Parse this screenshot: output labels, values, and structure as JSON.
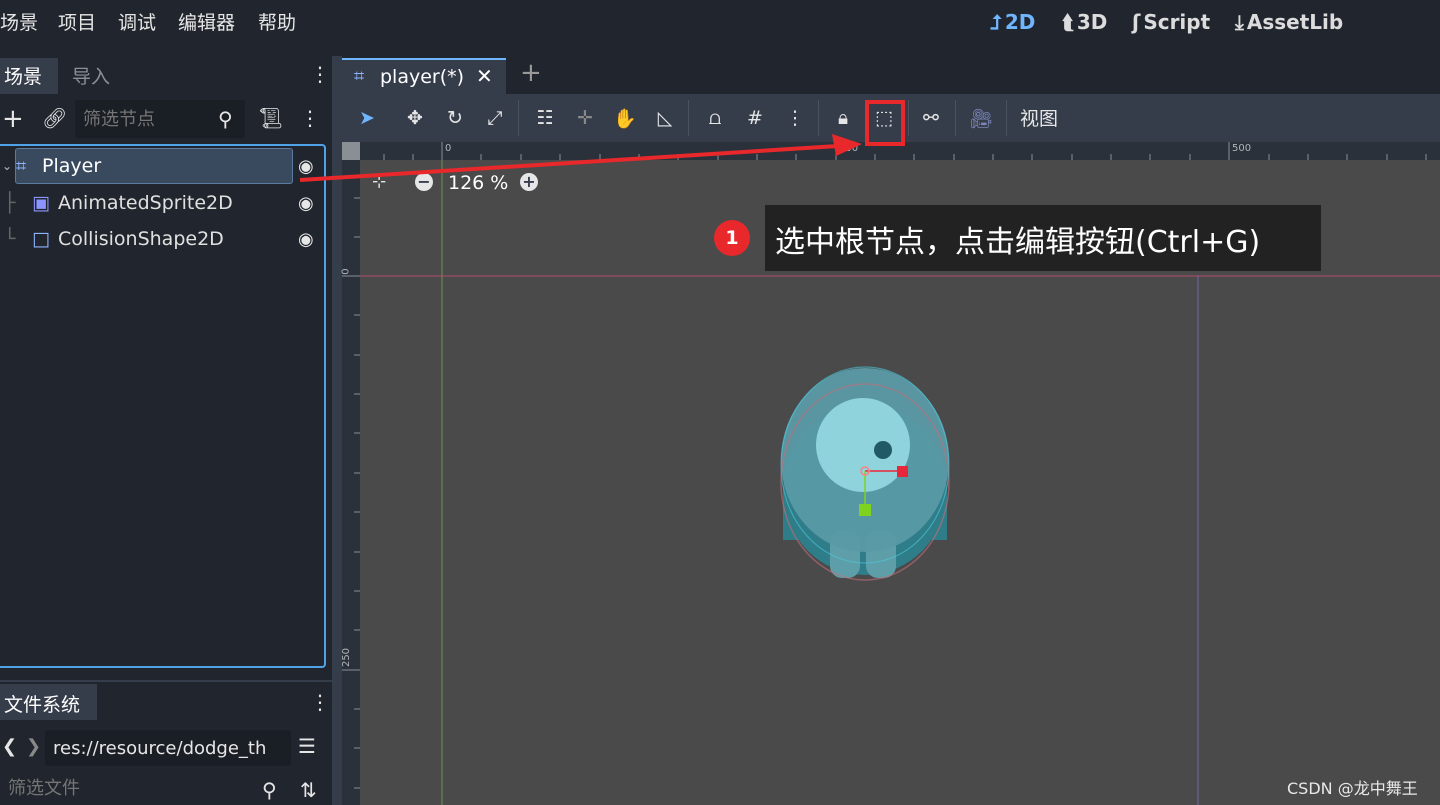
{
  "menubar": {
    "items": [
      "场景",
      "项目",
      "调试",
      "编辑器",
      "帮助"
    ],
    "workspaces": [
      {
        "label": "2D",
        "icon": "2d-icon",
        "active": true
      },
      {
        "label": "3D",
        "icon": "3d-icon",
        "active": false
      },
      {
        "label": "Script",
        "icon": "script-icon",
        "active": false
      },
      {
        "label": "AssetLib",
        "icon": "download-icon",
        "active": false
      }
    ]
  },
  "scene_dock": {
    "tabs": [
      "场景",
      "导入"
    ],
    "filter_placeholder": "筛选节点",
    "nodes": [
      {
        "label": "Player",
        "icon": "node2d-icon",
        "selected": true
      },
      {
        "label": "AnimatedSprite2D",
        "icon": "animated-sprite-icon",
        "selected": false
      },
      {
        "label": "CollisionShape2D",
        "icon": "collision-shape-icon",
        "selected": false
      }
    ]
  },
  "filesystem_dock": {
    "tab": "文件系统",
    "path": "res://resource/dodge_th",
    "filter_placeholder": "筛选文件"
  },
  "editor": {
    "tab_label": "player(*)",
    "view_menu": "视图",
    "zoom": "126 %",
    "ruler_top": [
      "0",
      "250",
      "500"
    ],
    "ruler_left": [
      "0",
      "250"
    ]
  },
  "annotation": {
    "number": "1",
    "text": "选中根节点，点击编辑按钮(Ctrl+G)"
  },
  "watermark": "CSDN @龙中舞王",
  "colors": {
    "accent": "#6fb6ff",
    "highlight_red": "#e8282b",
    "selection_border": "#4fa3e8"
  }
}
